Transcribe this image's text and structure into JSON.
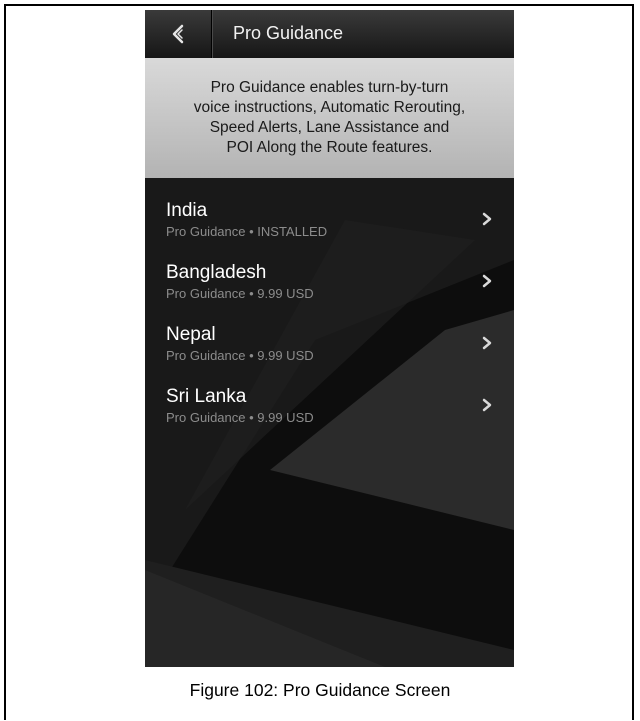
{
  "header": {
    "title": "Pro Guidance",
    "back_icon": "back-arrow-icon"
  },
  "banner": {
    "text": "Pro Guidance enables turn-by-turn\nvoice instructions, Automatic Rerouting,\nSpeed Alerts, Lane Assistance and\nPOI Along the Route features."
  },
  "countries": [
    {
      "name": "India",
      "subtitle": "Pro Guidance • INSTALLED"
    },
    {
      "name": "Bangladesh",
      "subtitle": "Pro Guidance • 9.99 USD"
    },
    {
      "name": "Nepal",
      "subtitle": "Pro Guidance • 9.99 USD"
    },
    {
      "name": "Sri Lanka",
      "subtitle": "Pro Guidance • 9.99 USD"
    }
  ],
  "caption": "Figure 102: Pro Guidance Screen",
  "colors": {
    "header": "#2a2a2a",
    "banner": "#c8c8c8",
    "background": "#0d0d0d"
  }
}
